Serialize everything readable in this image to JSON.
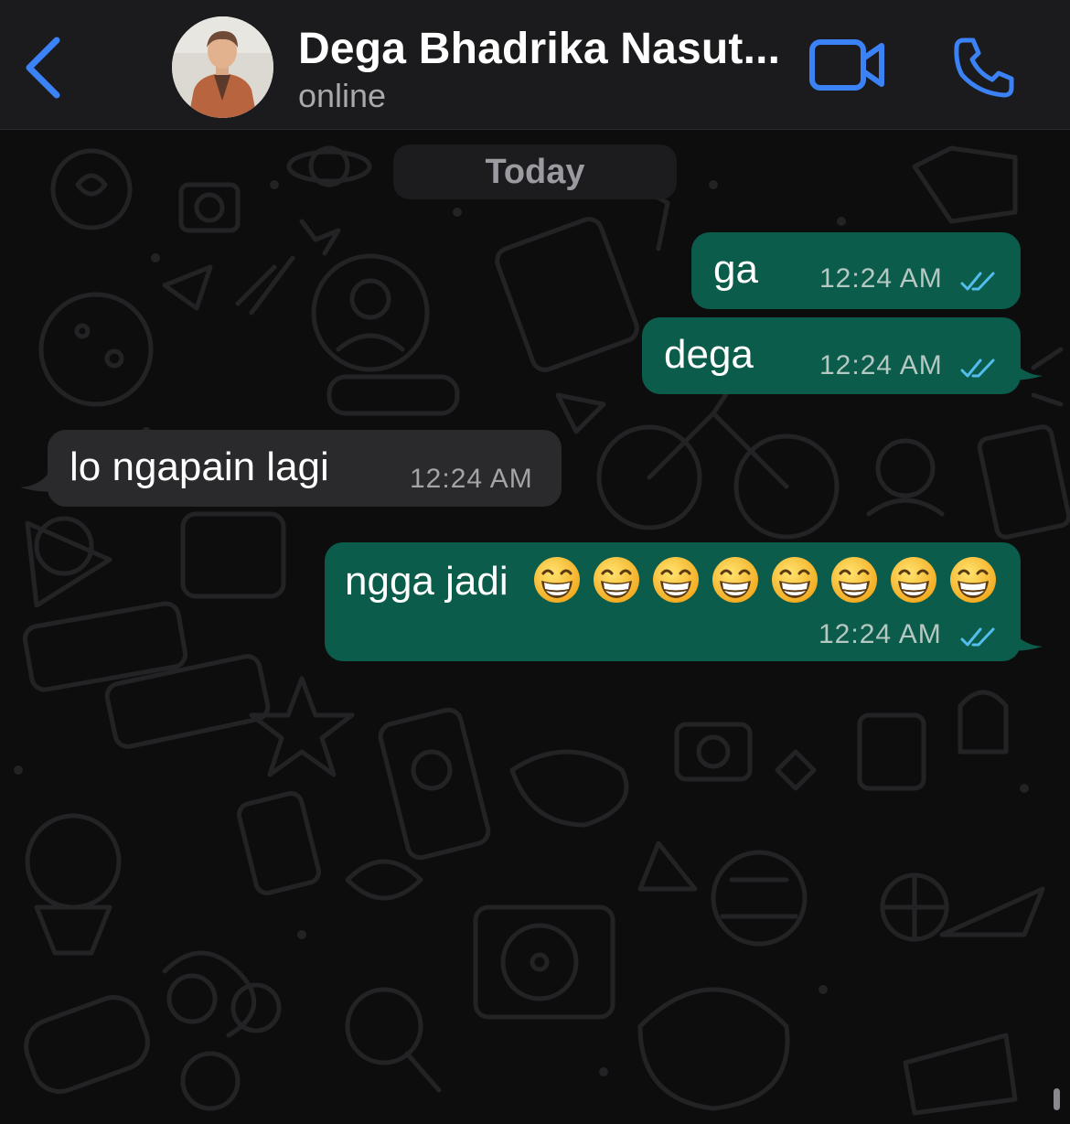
{
  "header": {
    "contact_name": "Dega Bhadrika Nasut...",
    "status": "online",
    "accent_color": "#3b82f6",
    "icons": [
      "chevron-left-icon",
      "video-camera-icon",
      "phone-icon"
    ]
  },
  "chat": {
    "date_label": "Today",
    "messages": [
      {
        "direction": "outgoing",
        "text": "ga",
        "time": "12:24 AM",
        "read": true
      },
      {
        "direction": "outgoing",
        "text": "dega",
        "time": "12:24 AM",
        "read": true
      },
      {
        "direction": "incoming",
        "text": "lo ngapain lagi",
        "time": "12:24 AM"
      },
      {
        "direction": "outgoing",
        "text": "ngga jadi",
        "emoji": "grinning-face-with-smiling-eyes",
        "emoji_count": 8,
        "time": "12:24 AM",
        "read": true
      }
    ]
  },
  "colors": {
    "header_bg": "#1b1b1d",
    "outgoing_bubble": "#0b5c4b",
    "incoming_bubble": "#2a2a2c",
    "read_ticks": "#53bdeb"
  }
}
